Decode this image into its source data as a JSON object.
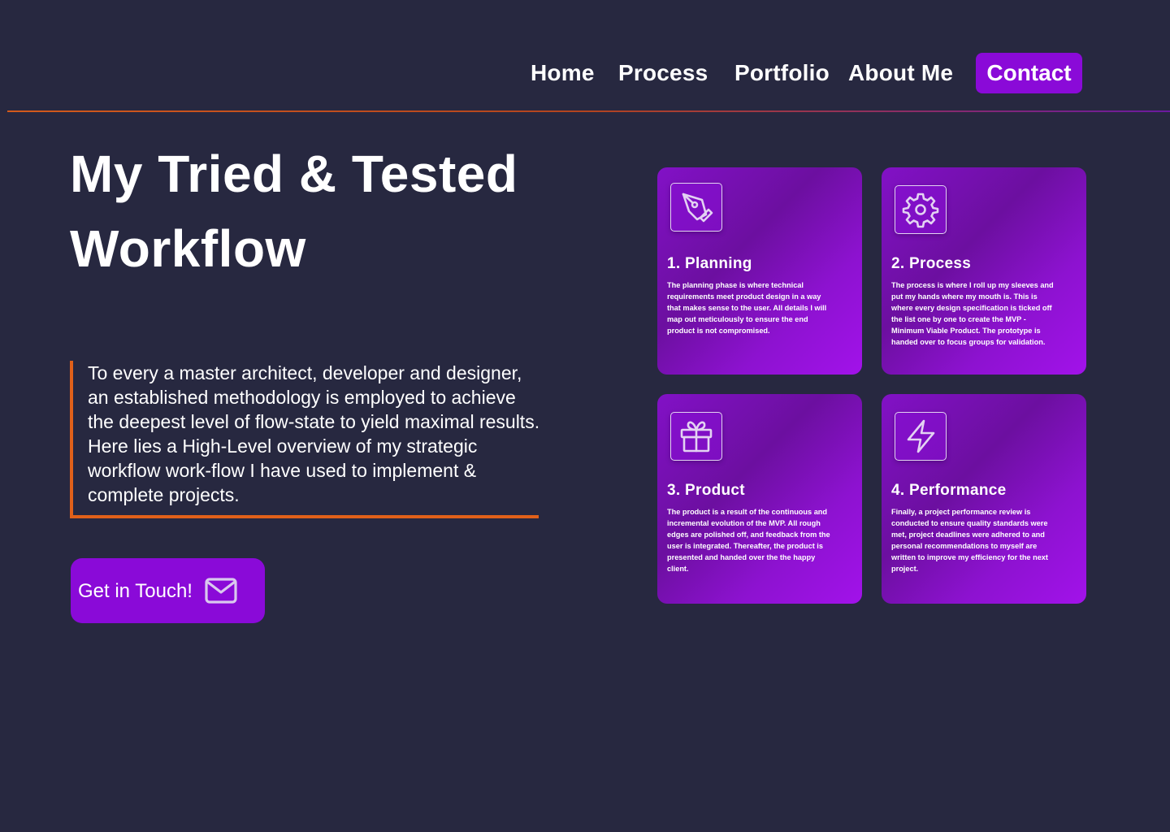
{
  "nav": {
    "items": [
      {
        "label": "Home"
      },
      {
        "label": "Process"
      },
      {
        "label": "Portfolio"
      },
      {
        "label": "About Me"
      }
    ],
    "contact_label": "Contact"
  },
  "hero": {
    "title_line1": "My Tried & Tested",
    "title_line2": "Workflow",
    "intro": "To every a master architect, developer and designer, an established methodology is employed to achieve the deepest level of flow-state to yield maximal results. Here lies a High-Level overview of  my strategic workflow work-flow I have used to implement & complete projects.",
    "cta_label": "Get in Touch!",
    "cta_icon": "mail-icon"
  },
  "cards": [
    {
      "title": "1. Planning",
      "icon": "pen-tool-icon",
      "body": "The planning phase is where technical requirements meet product design in a way that makes sense to the user. All details I will map out meticulously to ensure the end product is not compromised."
    },
    {
      "title": "2. Process",
      "icon": "gear-icon",
      "body": "The process is where I roll up my sleeves and put my hands where my mouth is. This is where every design specification is ticked off the list one by one to create the MVP - Minimum Viable Product. The prototype is handed over to focus groups for validation."
    },
    {
      "title": "3. Product",
      "icon": "gift-icon",
      "body": "The product is a result of the continuous and incremental evolution of the MVP. All rough edges are polished off, and feedback from the user is integrated. Thereafter, the product is presented and handed over the the happy client."
    },
    {
      "title": "4. Performance",
      "icon": "lightning-icon",
      "body": "Finally, a project performance review is conducted to ensure quality standards were met, project deadlines were adhered to and personal recommendations to myself are written to improve my efficiency for the next project."
    }
  ],
  "colors": {
    "background": "#272840",
    "accent_purple": "#8a0ad8",
    "accent_orange": "#e0601a",
    "text": "#ffffff"
  }
}
